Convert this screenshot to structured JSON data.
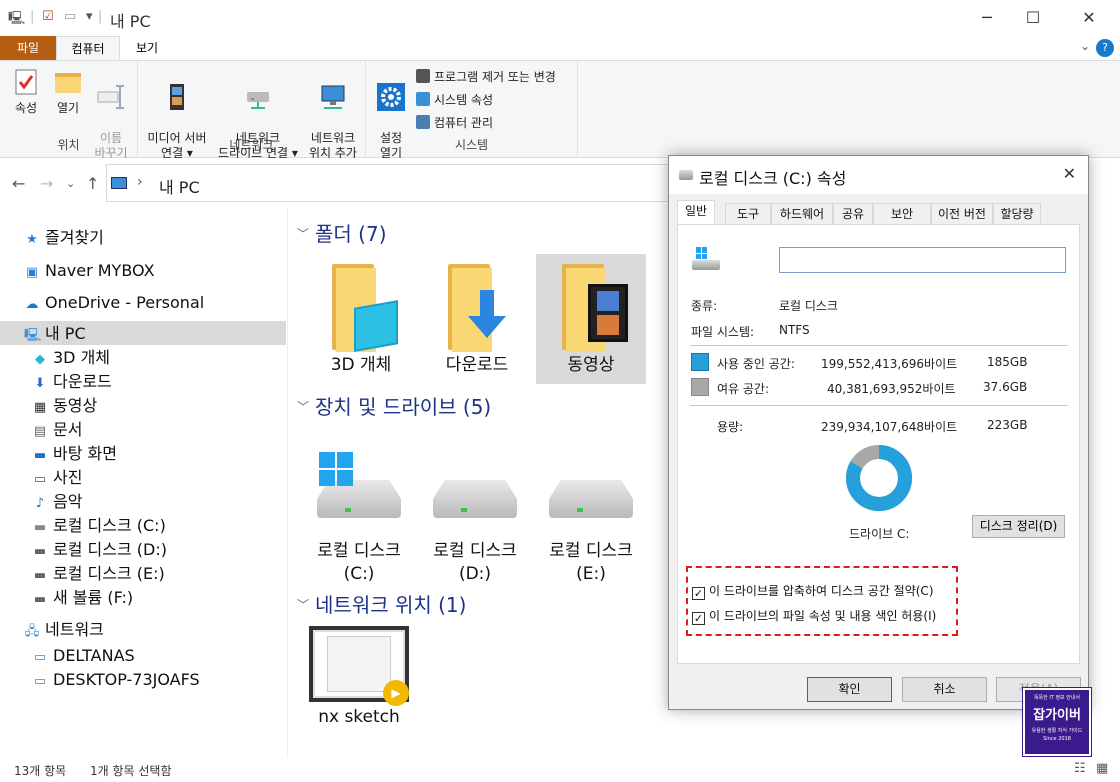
{
  "window": {
    "title": "내 PC"
  },
  "ribbon": {
    "tabs": [
      "파일",
      "컴퓨터",
      "보기"
    ],
    "groups": {
      "location": {
        "label": "위치",
        "buttons": [
          "속성",
          "열기",
          "이름\n바꾸기"
        ]
      },
      "network": {
        "label": "네트워크",
        "buttons": [
          "미디어 서버\n연결 ▾",
          "네트워크\n드라이브 연결 ▾",
          "네트워크\n위치 추가"
        ]
      },
      "system": {
        "label": "시스템",
        "open_settings": "설정\n열기",
        "small": [
          "프로그램 제거 또는 변경",
          "시스템 속성",
          "컴퓨터 관리"
        ]
      }
    }
  },
  "address": {
    "path": "내 PC"
  },
  "sidebar": {
    "items": [
      "즐겨찾기",
      "Naver MYBOX",
      "OneDrive - Personal",
      "내 PC",
      "3D 개체",
      "다운로드",
      "동영상",
      "문서",
      "바탕 화면",
      "사진",
      "음악",
      "로컬 디스크 (C:)",
      "로컬 디스크 (D:)",
      "로컬 디스크 (E:)",
      "새 볼륨 (F:)",
      "네트워크",
      "DELTANAS",
      "DESKTOP-73JOAFS"
    ]
  },
  "content": {
    "sections": [
      "폴더 (7)",
      "장치 및 드라이브 (5)",
      "네트워크 위치 (1)"
    ],
    "folders": [
      "3D 개체",
      "다운로드",
      "동영상"
    ],
    "drives": [
      {
        "line1": "로컬 디스크",
        "line2": "(C:)"
      },
      {
        "line1": "로컬 디스크",
        "line2": "(D:)"
      },
      {
        "line1": "로컬 디스크",
        "line2": "(E:)"
      }
    ],
    "network_item": "nx sketch"
  },
  "status": {
    "count": "13개 항목",
    "selected": "1개 항목 선택함"
  },
  "dialog": {
    "title": "로컬 디스크 (C:) 속성",
    "tabs": [
      "일반",
      "도구",
      "하드웨어",
      "공유",
      "보안",
      "이전 버전",
      "할당량"
    ],
    "name_value": "",
    "type_label": "종류:",
    "type_value": "로컬 디스크",
    "fs_label": "파일 시스템:",
    "fs_value": "NTFS",
    "used_label": "사용 중인 공간:",
    "used_bytes": "199,552,413,696바이트",
    "used_size": "185GB",
    "free_label": "여유 공간:",
    "free_bytes": "40,381,693,952바이트",
    "free_size": "37.6GB",
    "capacity_label": "용량:",
    "capacity_bytes": "239,934,107,648바이트",
    "capacity_size": "223GB",
    "used_fraction": 0.832,
    "drive_label": "드라이브 C:",
    "cleanup_button": "디스크 정리(D)",
    "compress_checkbox": "이 드라이브를 압축하여 디스크 공간 절약(C)",
    "index_checkbox": "이 드라이브의 파일 속성 및 내용 색인 허용(I)",
    "ok": "확인",
    "cancel": "취소",
    "apply": "적용(A)",
    "colors": {
      "used": "#26a0da",
      "free": "#a8a8a8"
    }
  },
  "watermark": {
    "top": "똑똑한 IT 정보 안내서",
    "brand": "잡가이버",
    "tag": "유용한 생활 지식 가이드",
    "since": "Since 2018"
  }
}
